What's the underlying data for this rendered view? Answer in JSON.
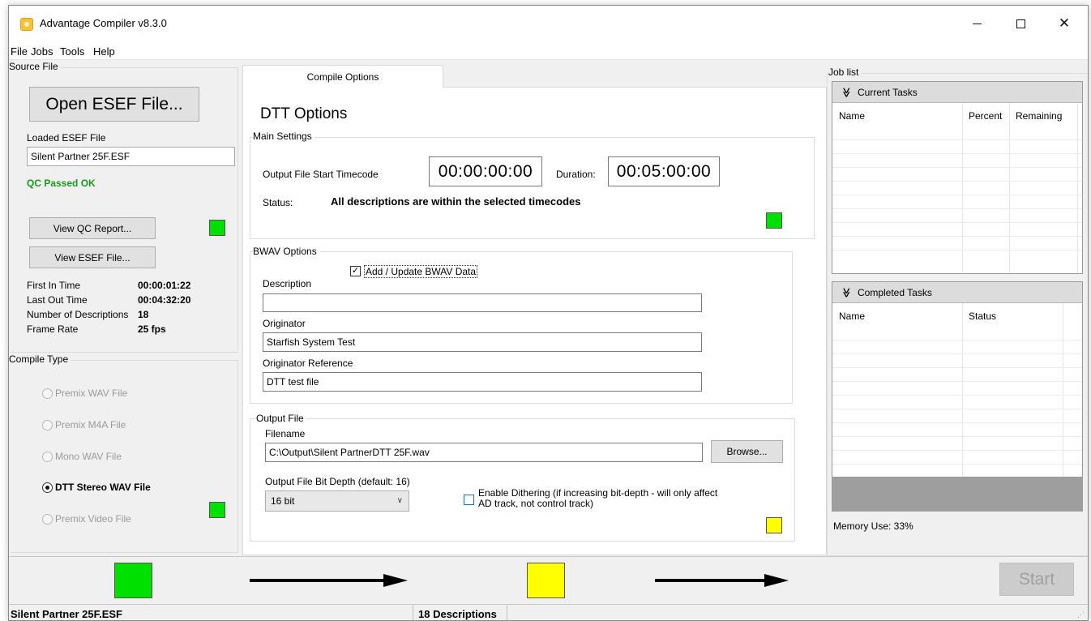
{
  "window": {
    "title": "Advantage Compiler v8.3.0",
    "controls": {
      "minimize_icon": "minimize-icon",
      "maximize_icon": "maximize-icon",
      "close_icon": "close-icon"
    },
    "close_glyph": "✕"
  },
  "menu": {
    "file": "File",
    "jobs": "Jobs",
    "tools": "Tools",
    "help": "Help"
  },
  "source": {
    "group_label": "Source File",
    "open_button": "Open ESEF File...",
    "loaded_label": "Loaded ESEF File",
    "loaded_value": "Silent Partner 25F.ESF",
    "qc_status": "QC Passed OK",
    "qc_status_color": "#1a9a1a",
    "view_qc_button": "View QC Report...",
    "view_esef_button": "View ESEF File...",
    "stats": [
      {
        "label": "First In Time",
        "value": "00:00:01:22"
      },
      {
        "label": "Last Out Time",
        "value": "00:04:32:20"
      },
      {
        "label": "Number of Descriptions",
        "value": "18"
      },
      {
        "label": "Frame Rate",
        "value": "25 fps"
      }
    ]
  },
  "compile_type": {
    "group_label": "Compile Type",
    "options": [
      {
        "label": "Premix WAV File",
        "selected": false
      },
      {
        "label": "Premix M4A File",
        "selected": false
      },
      {
        "label": "Mono WAV File",
        "selected": false
      },
      {
        "label": "DTT Stereo WAV File",
        "selected": true
      },
      {
        "label": "Premix Video File",
        "selected": false
      }
    ]
  },
  "compile_options": {
    "tab_label": "Compile Options",
    "heading": "DTT Options",
    "main_settings": {
      "group_label": "Main Settings",
      "start_tc_label": "Output File Start Timecode",
      "start_tc_value": "00:00:00:00",
      "duration_label": "Duration:",
      "duration_value": "00:05:00:00",
      "status_label": "Status:",
      "status_value": "All descriptions are within the selected timecodes"
    },
    "bwav": {
      "group_label": "BWAV Options",
      "add_update_label": "Add / Update BWAV Data",
      "add_update_checked": true,
      "check_glyph": "✓",
      "description_label": "Description",
      "description_value": "",
      "originator_label": "Originator",
      "originator_value": "Starfish System Test",
      "originator_ref_label": "Originator Reference",
      "originator_ref_value": "DTT test file"
    },
    "output_file": {
      "group_label": "Output File",
      "filename_label": "Filename",
      "filename_value": "C:\\Output\\Silent PartnerDTT 25F.wav",
      "browse_button": "Browse...",
      "bit_depth_label": "Output File Bit Depth (default: 16)",
      "bit_depth_value": "16 bit",
      "chevron_glyph": "∨",
      "dithering_label_line1": "Enable Dithering (if increasing bit-depth - will only affect",
      "dithering_label_line2": "AD track, not control track)",
      "dithering_checked": false
    }
  },
  "job_list": {
    "group_label": "Job list",
    "current_tasks": {
      "title": "Current Tasks",
      "columns": [
        "Name",
        "Percent",
        "Remaining"
      ]
    },
    "completed_tasks": {
      "title": "Completed Tasks",
      "columns": [
        "Name",
        "Status"
      ]
    },
    "chevron_glyph": "≫",
    "memory_use": "Memory Use: 33%"
  },
  "progress": {
    "colors": {
      "green": "#00e000",
      "yellow": "#ffff00"
    },
    "start_button": "Start"
  },
  "statusbar": {
    "file": "Silent Partner 25F.ESF",
    "descriptions": "18 Descriptions"
  }
}
